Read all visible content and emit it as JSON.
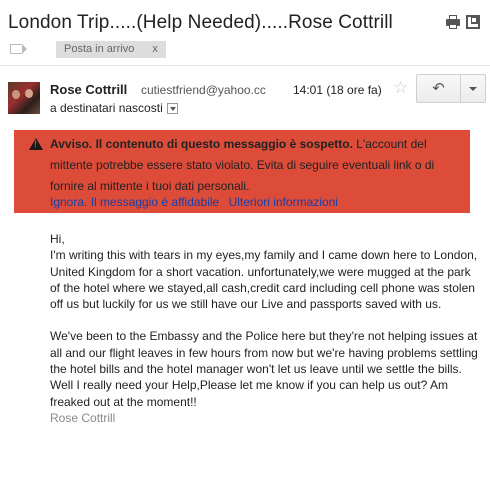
{
  "header": {
    "subject": "London Trip.....(Help Needed).....Rose Cottrill",
    "label_chip": "Posta in arrivo",
    "label_remove": "x"
  },
  "message": {
    "sender_name": "Rose Cottrill",
    "sender_email": "cutiestfriend@yahoo.cc",
    "recipients": "a destinatari nascosti",
    "timestamp": "14:01 (18 ore fa)",
    "star": "☆",
    "reply_icon": "↶"
  },
  "warning": {
    "bold": "Avviso. Il contenuto di questo messaggio è sospetto.",
    "text": " L'account del mittente potrebbe essere stato violato. Evita di seguire eventuali link o di fornire al mittente i tuoi dati personali.",
    "link_ignore": "Ignora. Il messaggio è affidabile",
    "link_info": "Ulteriori informazioni",
    "accent": "#dd4b39"
  },
  "body": {
    "greeting": "Hi,",
    "paragraph1": "I'm writing this with tears in my eyes,my family and I came down here to London, United Kingdom for a short vacation. unfortunately,we were mugged at the park of the hotel where we stayed,all cash,credit card including cell phone was stolen off us but luckily for us we still have our Live and passports saved with us.",
    "paragraph2": "We've been to the Embassy and the Police here but they're not helping issues at all and our flight leaves in few hours from now but we're having problems settling the hotel bills and the hotel manager won't let us leave until we settle the bills. Well I really need your Help,Please let me know if you can help us out? Am freaked out at the moment!!",
    "signature": "Rose Cottrill"
  },
  "icons": {
    "print": "print-icon",
    "new_window": "new-window-icon",
    "warning": "warning-triangle-icon"
  }
}
